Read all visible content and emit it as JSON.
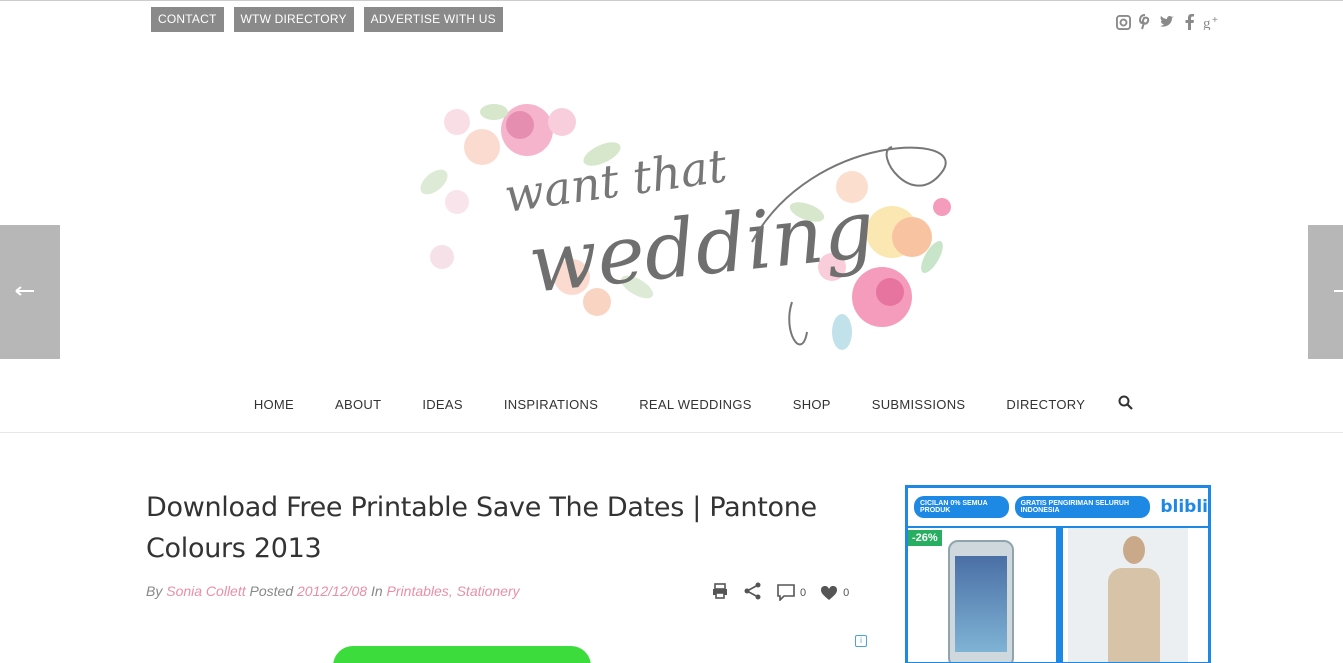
{
  "topbar": {
    "links": [
      "CONTACT",
      "WTW DIRECTORY",
      "ADVERTISE WITH US"
    ]
  },
  "social_icons": [
    "instagram-icon",
    "pinterest-icon",
    "twitter-icon",
    "facebook-icon",
    "google-plus-icon"
  ],
  "logo": {
    "line1": "want that",
    "line2": "wedding"
  },
  "nav": {
    "items": [
      "HOME",
      "ABOUT",
      "IDEAS",
      "INSPIRATIONS",
      "REAL WEDDINGS",
      "SHOP",
      "SUBMISSIONS",
      "DIRECTORY"
    ]
  },
  "article": {
    "title": "Download Free Printable Save The Dates | Pantone Colours 2013",
    "by_label": "By",
    "author": "Sonia Collett",
    "posted_label": "Posted",
    "date": "2012/12/08",
    "in_label": "In",
    "category1": "Printables",
    "category2": "Stationery",
    "comments_count": "0",
    "likes_count": "0"
  },
  "ad": {
    "pill1": "CICILAN 0% SEMUA PRODUK",
    "pill2": "GRATIS PENGIRIMAN SELURUH INDONESIA",
    "brand": "blibli",
    "discount": "-26%"
  },
  "colors": {
    "accent_pink": "#e88fa6",
    "topbar_gray": "#8a8a8a",
    "ad_blue": "#1e88e5"
  }
}
